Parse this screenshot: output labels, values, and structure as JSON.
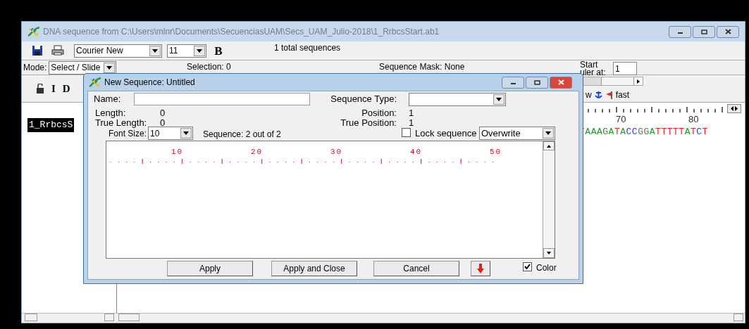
{
  "window": {
    "title": "DNA sequence from C:\\Users\\mlnr\\Documents\\SecuenciasUAM\\Secs_UAM_Julio-2018\\1_RrbcsStart.ab1"
  },
  "toolbar": {
    "font": "Courier New",
    "size": "11",
    "bold": "B",
    "total": "1 total sequences"
  },
  "mode_bar": {
    "mode_label": "Mode:",
    "mode": "Select / Slide",
    "selection": "Selection: 0",
    "mask": "Sequence Mask: None",
    "start_line_1": "Start",
    "start_line_2": "uler at:",
    "start_value": "1"
  },
  "tools": [
    "I",
    "D"
  ],
  "speed": {
    "left": "w",
    "right": "fast"
  },
  "sequence_list": [
    {
      "name": "1_RrbcsS",
      "selected": true
    }
  ],
  "alignment": {
    "ruler": [
      "70",
      "80"
    ],
    "bases": "TAAAGATACCGGATTTTTATCT"
  },
  "dialog": {
    "title": "New Sequence: Untitled",
    "name_label": "Name:",
    "type_label": "Sequence Type:",
    "length": "Length:",
    "length_value": "0",
    "true_length": "True Length:",
    "true_length_value": "0",
    "position": "Position:",
    "position_value": "1",
    "true_position": "True Position:",
    "true_position_value": "1",
    "font_size_label": "Font Size:",
    "font_size": "10",
    "sequence_count": "Sequence: 2 out of 2",
    "lock": {
      "label": "Lock sequence",
      "checked": false
    },
    "edit_mode": "Overwrite",
    "ruler": [
      "10",
      "20",
      "30",
      "40",
      "50"
    ],
    "buttons": [
      "Apply",
      "Apply and Close",
      "Cancel"
    ],
    "color": {
      "label": "Color",
      "checked": true
    }
  }
}
